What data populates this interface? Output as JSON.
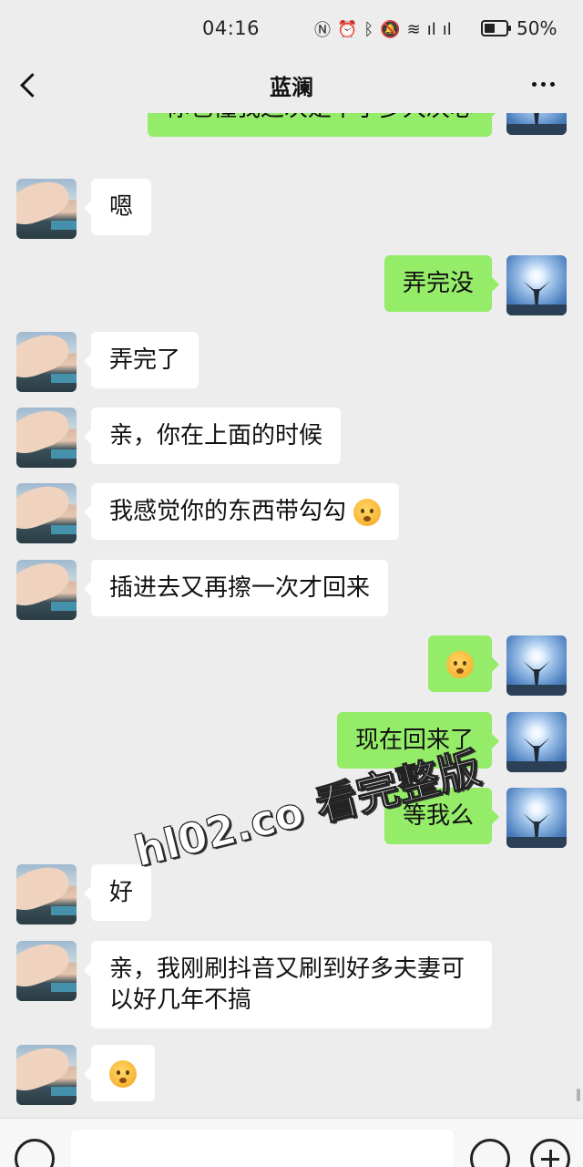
{
  "status_bar": {
    "time": "04:16",
    "icons": [
      "nfc-icon",
      "alarm-icon",
      "bluetooth-icon",
      "mute-icon",
      "wifi-icon",
      "signal-5g-icon",
      "signal-4g-icon",
      "battery-icon"
    ],
    "battery_level": 0.5,
    "battery": "50%"
  },
  "nav": {
    "title": "蓝澜"
  },
  "messages": [
    {
      "side": "right",
      "text": "你也懂我这次是下了多大决心"
    },
    {
      "side": "left",
      "text": "嗯"
    },
    {
      "side": "right",
      "text": "弄完没"
    },
    {
      "side": "left",
      "text": "弄完了"
    },
    {
      "side": "left",
      "text": "亲，你在上面的时候"
    },
    {
      "side": "left",
      "text": "我感觉你的东西带勾勾"
    },
    {
      "side": "left",
      "text": "插进去又再擦一次才回来"
    },
    {
      "side": "right",
      "text": ""
    },
    {
      "side": "right",
      "text": "现在回来了"
    },
    {
      "side": "right",
      "text": "等我么"
    },
    {
      "side": "left",
      "text": "好"
    },
    {
      "side": "left",
      "text": "亲，我刚刷抖音又刷到好多夫妻可以好几年不搞"
    },
    {
      "side": "left",
      "text": ""
    }
  ],
  "watermark": "hl02.co 看完整版",
  "colors": {
    "background": "#ededed",
    "bubble_self": "#95ec69",
    "bubble_other": "#ffffff"
  }
}
